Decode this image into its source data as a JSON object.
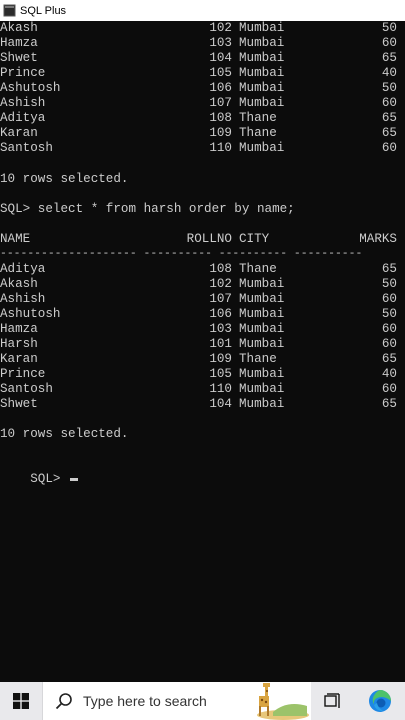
{
  "window": {
    "title": "SQL Plus"
  },
  "console": {
    "top_rows": [
      {
        "name": "Akash",
        "rollno": "102",
        "city": "Mumbai",
        "marks": "50"
      },
      {
        "name": "Hamza",
        "rollno": "103",
        "city": "Mumbai",
        "marks": "60"
      },
      {
        "name": "Shwet",
        "rollno": "104",
        "city": "Mumbai",
        "marks": "65"
      },
      {
        "name": "Prince",
        "rollno": "105",
        "city": "Mumbai",
        "marks": "40"
      },
      {
        "name": "Ashutosh",
        "rollno": "106",
        "city": "Mumbai",
        "marks": "50"
      },
      {
        "name": "Ashish",
        "rollno": "107",
        "city": "Mumbai",
        "marks": "60"
      },
      {
        "name": "Aditya",
        "rollno": "108",
        "city": "Thane",
        "marks": "65"
      },
      {
        "name": "Karan",
        "rollno": "109",
        "city": "Thane",
        "marks": "65"
      },
      {
        "name": "Santosh",
        "rollno": "110",
        "city": "Mumbai",
        "marks": "60"
      }
    ],
    "rows_selected_1": "10 rows selected.",
    "query": "SQL> select * from harsh order by name;",
    "headers": {
      "name": "NAME",
      "rollno": "ROLLNO",
      "city": "CITY",
      "marks": "MARKS"
    },
    "separator": "-------------------- ---------- ---------- ----------",
    "sorted_rows": [
      {
        "name": "Aditya",
        "rollno": "108",
        "city": "Thane",
        "marks": "65"
      },
      {
        "name": "Akash",
        "rollno": "102",
        "city": "Mumbai",
        "marks": "50"
      },
      {
        "name": "Ashish",
        "rollno": "107",
        "city": "Mumbai",
        "marks": "60"
      },
      {
        "name": "Ashutosh",
        "rollno": "106",
        "city": "Mumbai",
        "marks": "50"
      },
      {
        "name": "Hamza",
        "rollno": "103",
        "city": "Mumbai",
        "marks": "60"
      },
      {
        "name": "Harsh",
        "rollno": "101",
        "city": "Mumbai",
        "marks": "60"
      },
      {
        "name": "Karan",
        "rollno": "109",
        "city": "Thane",
        "marks": "65"
      },
      {
        "name": "Prince",
        "rollno": "105",
        "city": "Mumbai",
        "marks": "40"
      },
      {
        "name": "Santosh",
        "rollno": "110",
        "city": "Mumbai",
        "marks": "60"
      },
      {
        "name": "Shwet",
        "rollno": "104",
        "city": "Mumbai",
        "marks": "65"
      }
    ],
    "rows_selected_2": "10 rows selected.",
    "prompt": "SQL> "
  },
  "taskbar": {
    "search_placeholder": "Type here to search",
    "icons": [
      "windows-start-icon",
      "search-icon",
      "task-view-icon",
      "edge-browser-icon"
    ]
  }
}
